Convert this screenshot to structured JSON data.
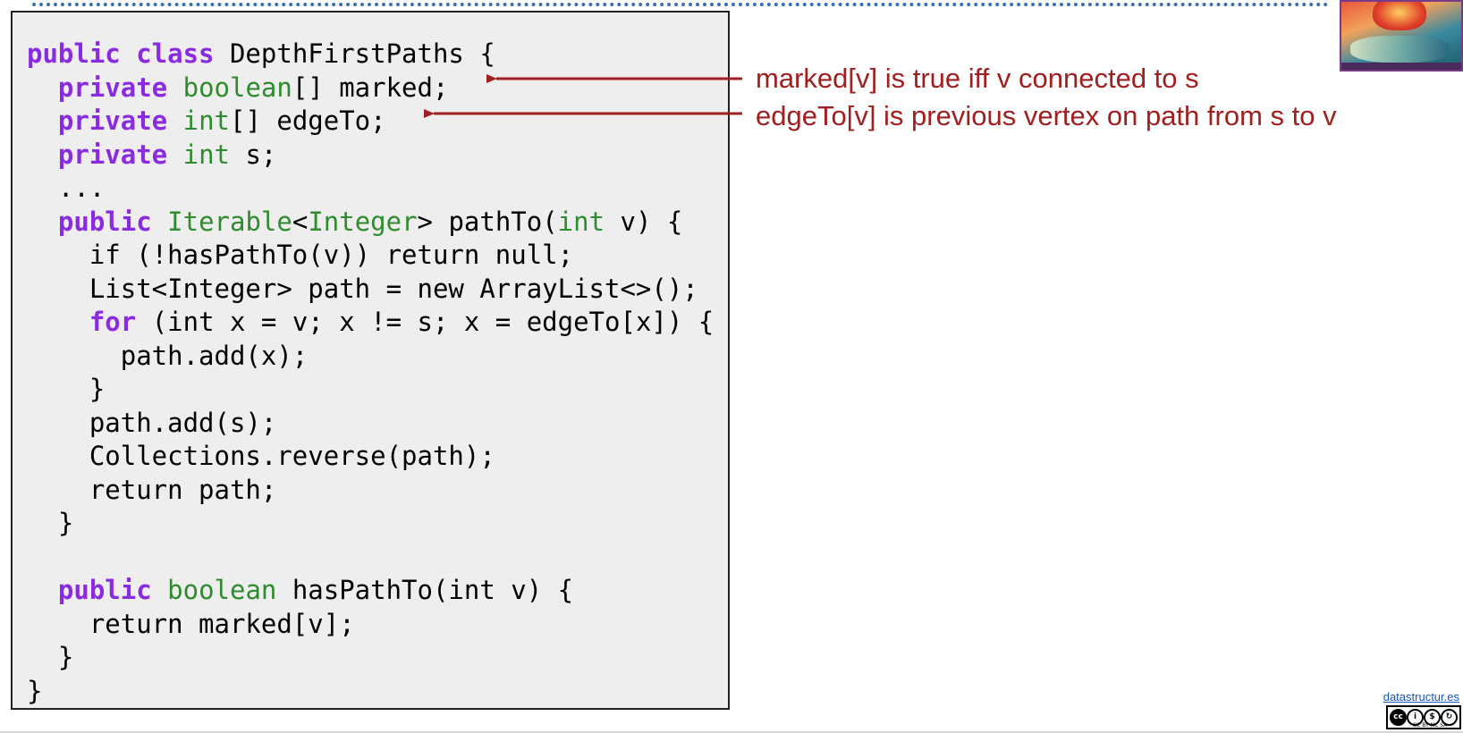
{
  "code": {
    "lines": [
      [
        {
          "t": "public class",
          "s": "kw"
        },
        {
          "t": " DepthFirstPaths {",
          "s": "plain"
        }
      ],
      [
        {
          "t": "  ",
          "s": "plain"
        },
        {
          "t": "private",
          "s": "kw"
        },
        {
          "t": " ",
          "s": "plain"
        },
        {
          "t": "boolean",
          "s": "type"
        },
        {
          "t": "[] marked;",
          "s": "plain"
        }
      ],
      [
        {
          "t": "  ",
          "s": "plain"
        },
        {
          "t": "private",
          "s": "kw"
        },
        {
          "t": " ",
          "s": "plain"
        },
        {
          "t": "int",
          "s": "type"
        },
        {
          "t": "[] edgeTo;",
          "s": "plain"
        }
      ],
      [
        {
          "t": "  ",
          "s": "plain"
        },
        {
          "t": "private",
          "s": "kw"
        },
        {
          "t": " ",
          "s": "plain"
        },
        {
          "t": "int",
          "s": "type"
        },
        {
          "t": " s;",
          "s": "plain"
        }
      ],
      [
        {
          "t": "  ...",
          "s": "plain"
        }
      ],
      [
        {
          "t": "  ",
          "s": "plain"
        },
        {
          "t": "public",
          "s": "kw"
        },
        {
          "t": " ",
          "s": "plain"
        },
        {
          "t": "Iterable",
          "s": "type"
        },
        {
          "t": "<",
          "s": "plain"
        },
        {
          "t": "Integer",
          "s": "type"
        },
        {
          "t": "> pathTo(",
          "s": "plain"
        },
        {
          "t": "int",
          "s": "type"
        },
        {
          "t": " v) {",
          "s": "plain"
        }
      ],
      [
        {
          "t": "    if (!hasPathTo(v)) return null;",
          "s": "plain"
        }
      ],
      [
        {
          "t": "    List<Integer> path = new ArrayList<>();",
          "s": "plain"
        }
      ],
      [
        {
          "t": "    ",
          "s": "plain"
        },
        {
          "t": "for",
          "s": "kw"
        },
        {
          "t": " (int x = v; x != s; x = edgeTo[x]) {",
          "s": "plain"
        }
      ],
      [
        {
          "t": "      path.add(x);",
          "s": "plain"
        }
      ],
      [
        {
          "t": "    }",
          "s": "plain"
        }
      ],
      [
        {
          "t": "    path.add(s);",
          "s": "plain"
        }
      ],
      [
        {
          "t": "    Collections.reverse(path);",
          "s": "plain"
        }
      ],
      [
        {
          "t": "    return path;",
          "s": "plain"
        }
      ],
      [
        {
          "t": "  }",
          "s": "plain"
        }
      ],
      [
        {
          "t": "",
          "s": "plain"
        }
      ],
      [
        {
          "t": "  ",
          "s": "plain"
        },
        {
          "t": "public",
          "s": "kw"
        },
        {
          "t": " ",
          "s": "plain"
        },
        {
          "t": "boolean",
          "s": "type"
        },
        {
          "t": " hasPathTo(int v) {",
          "s": "plain"
        }
      ],
      [
        {
          "t": "    return marked[v];",
          "s": "plain"
        }
      ],
      [
        {
          "t": "  }",
          "s": "plain"
        }
      ],
      [
        {
          "t": "}",
          "s": "plain"
        }
      ]
    ]
  },
  "annotations": {
    "marked": "marked[v] is true iff v connected to s",
    "edgeTo": "edgeTo[v] is previous vertex on path from s to v"
  },
  "footer": {
    "site_link": "datastructur.es",
    "license_badge": "CC BY NC SA"
  },
  "colors": {
    "keyword": "#8a2be2",
    "type": "#2e8b2e",
    "annotation": "#a02020",
    "code_background": "#eeeeee",
    "rule": "#3b6fb3"
  },
  "icons": {
    "logo": "lotus-dragon-logo",
    "license": "creative-commons-icon"
  }
}
